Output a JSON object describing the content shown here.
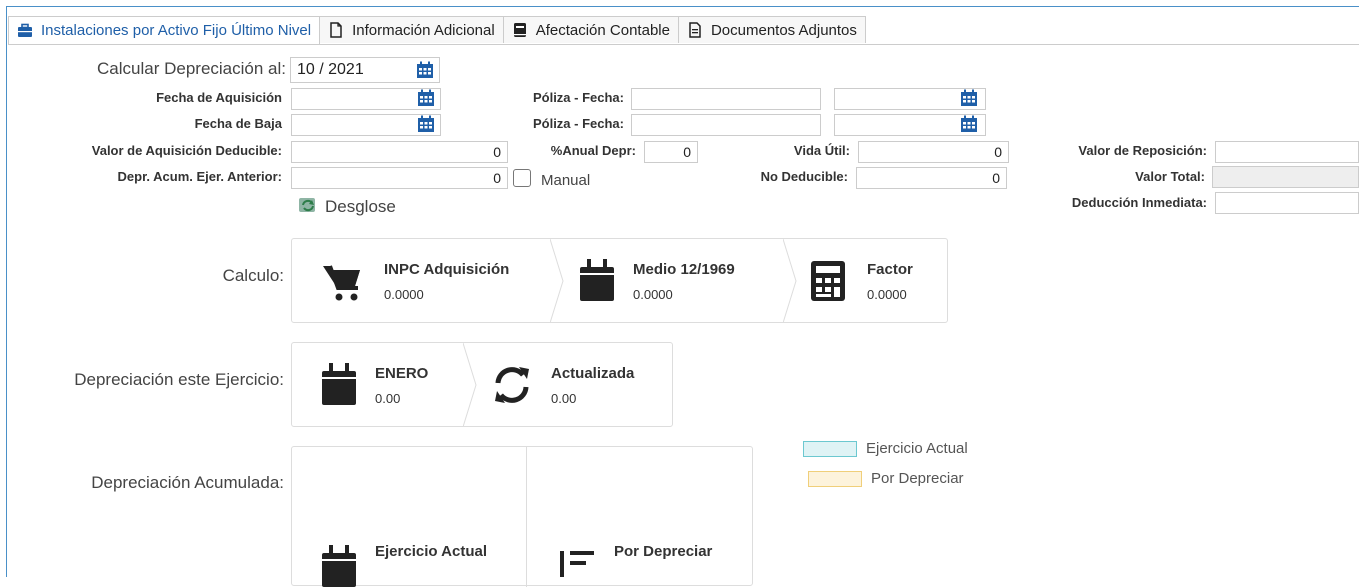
{
  "tabs": [
    {
      "label": "Instalaciones por Activo Fijo Último Nivel",
      "icon": "briefcase-icon"
    },
    {
      "label": "Información Adicional",
      "icon": "file-icon"
    },
    {
      "label": "Afectación Contable",
      "icon": "book-icon"
    },
    {
      "label": "Documentos Adjuntos",
      "icon": "document-icon"
    }
  ],
  "form": {
    "calc_label": "Calcular Depreciación al:",
    "calc_value": "10 / 2021",
    "fecha_adq_label": "Fecha de Aquisición",
    "fecha_baja_label": "Fecha de Baja",
    "poliza1_label": "Póliza - Fecha:",
    "poliza2_label": "Póliza - Fecha:",
    "valor_adq_label": "Valor de Aquisición Deducible:",
    "valor_adq_value": "0",
    "anual_label": "%Anual Depr:",
    "anual_value": "0",
    "vida_label": "Vida Útil:",
    "vida_value": "0",
    "reposicion_label": "Valor de Reposición:",
    "depr_acum_label": "Depr. Acum. Ejer. Anterior:",
    "depr_acum_value": "0",
    "manual_label": "Manual",
    "no_deducible_label": "No Deducible:",
    "no_deducible_value": "0",
    "valor_total_label": "Valor Total:",
    "deduccion_label": "Deducción Inmediata:",
    "desglose_label": "Desglose"
  },
  "calculo": {
    "label": "Calculo:",
    "items": [
      {
        "title": "INPC Adquisición",
        "value": "0.0000",
        "icon": "cart-icon"
      },
      {
        "title": "Medio 12/1969",
        "value": "0.0000",
        "icon": "calendar-icon"
      },
      {
        "title": "Factor",
        "value": "0.0000",
        "icon": "calculator-icon"
      }
    ]
  },
  "depr_ejercicio": {
    "label": "Depreciación este Ejercicio:",
    "items": [
      {
        "title": "ENERO",
        "value": "0.00",
        "icon": "calendar-icon"
      },
      {
        "title": "Actualizada",
        "value": "0.00",
        "icon": "refresh-icon"
      }
    ]
  },
  "depr_acumulada": {
    "label": "Depreciación Acumulada:",
    "items": [
      {
        "title": "Ejercicio Actual",
        "icon": "calendar-icon"
      },
      {
        "title": "Por Depreciar",
        "icon": "sort-icon"
      }
    ]
  },
  "legend": [
    {
      "label": "Ejercicio Actual",
      "color": "#dff3f5",
      "border": "#6cc8d0"
    },
    {
      "label": "Por Depreciar",
      "color": "#fdf3dc",
      "border": "#f0cf7a"
    }
  ]
}
